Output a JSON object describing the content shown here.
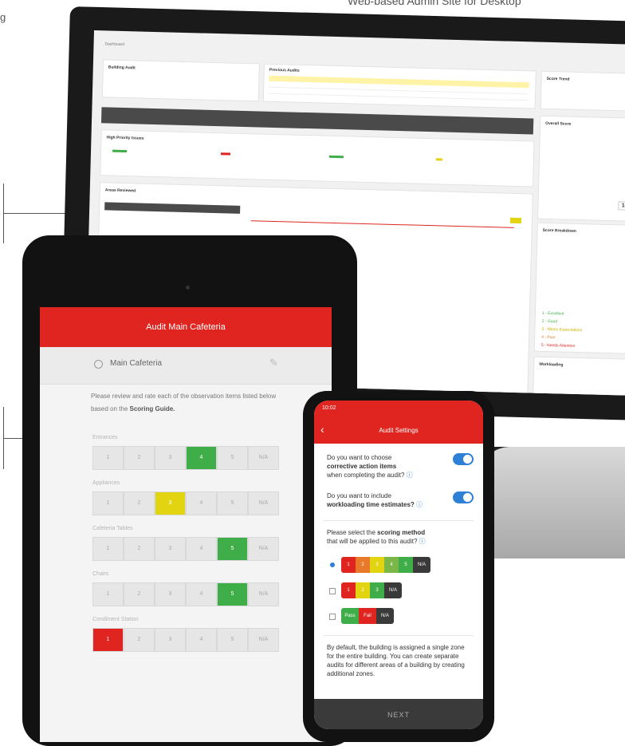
{
  "caption": "Web-based Admin Site for Desktop",
  "left_fragment": "g",
  "desktop": {
    "breadcrumb": "Dashboard",
    "building_title": "Building Audit",
    "previous_audits_title": "Previous Audits",
    "score_trend_title": "Score Trend",
    "high_priority_title": "High Priority Issues",
    "areas_title": "Areas Reviewed",
    "overall_score_title": "Overall Score",
    "breakdown_title": "Score Breakdown",
    "workloading_title": "Workloading",
    "overall_score_value": "100",
    "legend": [
      "1 - Excellent",
      "2 - Good",
      "3 - Meets Expectations",
      "4 - Poor",
      "5 - Needs Attention"
    ]
  },
  "tablet": {
    "header_title": "Audit Main Cafeteria",
    "zone_name": "Main Cafeteria",
    "instructions_lead": "Please review and rate each of the observation items listed below based on the",
    "instructions_bold": "Scoring Guide.",
    "questions": [
      {
        "label": "Entrances",
        "selected": "4",
        "color": "green"
      },
      {
        "label": "Appliances",
        "selected": "3",
        "color": "yellow"
      },
      {
        "label": "Cafeteria Tables",
        "selected": "5",
        "color": "green"
      },
      {
        "label": "Chairs",
        "selected": "5",
        "color": "green"
      },
      {
        "label": "Condiment Station",
        "selected": "1",
        "color": "red"
      }
    ],
    "scale_labels": [
      "1",
      "2",
      "3",
      "4",
      "5",
      "N/A"
    ]
  },
  "phone": {
    "time": "10:02",
    "header_title": "Audit Settings",
    "q1_lead": "Do you want to choose",
    "q1_bold": "corrective action items",
    "q1_tail": "when completing the audit?",
    "q2_lead": "Do you want to include",
    "q2_bold": "workloading time estimates?",
    "q3_lead": "Please select the",
    "q3_bold": "scoring method",
    "q3_tail": "that will be applied to this audit?",
    "option1_labels": [
      "1",
      "2",
      "3",
      "4",
      "5",
      "N/A"
    ],
    "option2_labels": [
      "1",
      "2",
      "3",
      "N/A"
    ],
    "option3_labels": [
      "Pass",
      "Fail",
      "N/A"
    ],
    "info_text": "By default, the building is assigned a single zone for the entire building. You can create separate audits for different areas of a building by creating additional zones.",
    "next_label": "NEXT"
  },
  "colors": {
    "brand_red": "#e02520",
    "green": "#3fae48",
    "yellow": "#e3d412",
    "orange": "#e8782a",
    "toggle_blue": "#2e7fd6"
  }
}
